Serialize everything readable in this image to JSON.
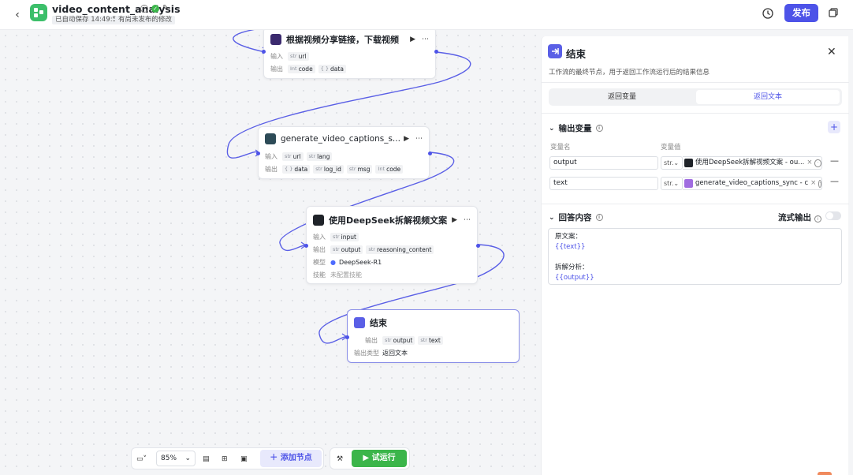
{
  "header": {
    "app_title": "video_content_analysis",
    "saved_status": "已自动保存 14:49:55",
    "unpublished": "有尚未发布的修改",
    "publish_label": "发布",
    "accent": "#4d53e8"
  },
  "nodes": {
    "download": {
      "title": "根据视频分享链接，下载视频",
      "input_label": "输入",
      "inputs": [
        {
          "type": "str",
          "name": "url"
        }
      ],
      "output_label": "输出",
      "outputs": [
        {
          "type": "Int",
          "name": "code"
        },
        {
          "type": "{ }",
          "name": "data"
        }
      ]
    },
    "captions": {
      "title": "generate_video_captions_s...",
      "input_label": "输入",
      "inputs": [
        {
          "type": "str",
          "name": "url"
        },
        {
          "type": "str",
          "name": "lang"
        }
      ],
      "output_label": "输出",
      "outputs": [
        {
          "type": "{ }",
          "name": "data"
        },
        {
          "type": "str",
          "name": "log_id"
        },
        {
          "type": "str",
          "name": "msg"
        },
        {
          "type": "Int",
          "name": "code"
        }
      ]
    },
    "deepseek": {
      "title": "使用DeepSeek拆解视频文案",
      "input_label": "输入",
      "inputs": [
        {
          "type": "str",
          "name": "input"
        }
      ],
      "output_label": "输出",
      "outputs": [
        {
          "type": "str",
          "name": "output"
        },
        {
          "type": "str",
          "name": "reasoning_content"
        }
      ],
      "model_label": "模型",
      "model": "DeepSeek-R1",
      "skill_label": "技能",
      "skill": "未配置技能"
    },
    "end": {
      "title": "结束",
      "output_label": "输出",
      "outputs": [
        {
          "type": "str",
          "name": "output"
        },
        {
          "type": "str",
          "name": "text"
        }
      ],
      "output_type_label": "输出类型",
      "output_type": "返回文本"
    }
  },
  "toolbar": {
    "zoom": "85%",
    "add_node": "添加节点",
    "run": "试运行"
  },
  "panel": {
    "title": "结束",
    "description": "工作流的最终节点，用于返回工作流运行后的结果信息",
    "tab_return_vars": "返回变量",
    "tab_return_text": "返回文本",
    "output_vars_title": "输出变量",
    "col_name": "变量名",
    "col_value": "变量值",
    "vars": [
      {
        "name": "output",
        "type": "str.",
        "value": "使用DeepSeek拆解视频文案 - ou..."
      },
      {
        "name": "text",
        "type": "str.",
        "value": "generate_video_captions_sync - c"
      }
    ],
    "answer_title": "回答内容",
    "stream_label": "流式输出",
    "answer_lines": [
      "原文案：",
      "{{text}}",
      "",
      "拆解分析：",
      "{{output}}"
    ]
  }
}
